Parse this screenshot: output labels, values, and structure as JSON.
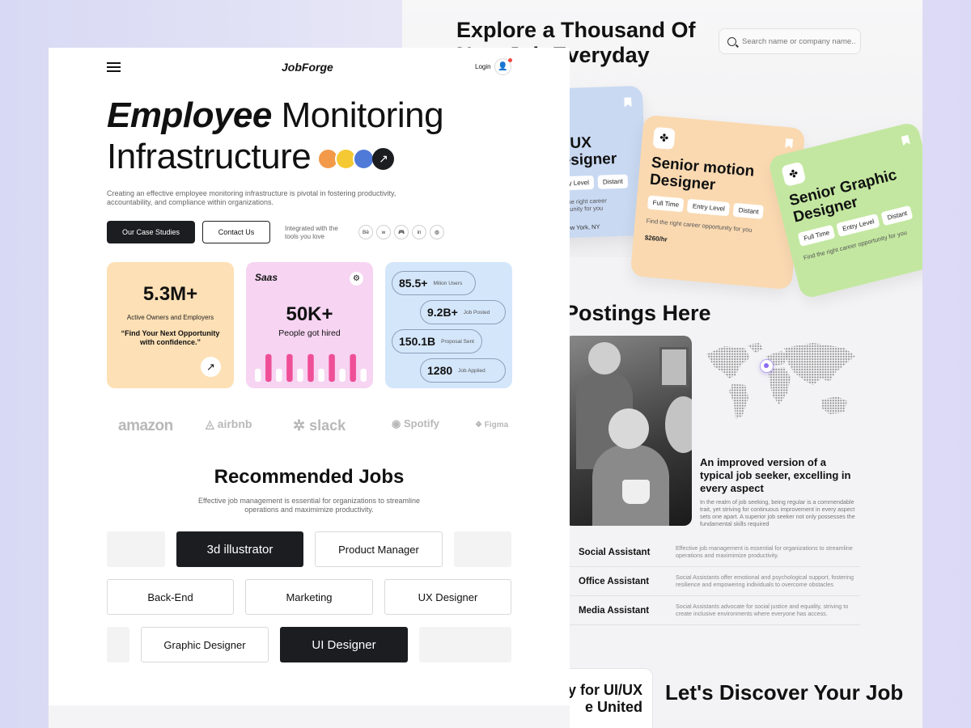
{
  "back": {
    "explore_title": "Explore a Thousand Of New Job Everyday",
    "search_placeholder": "Search name or company name..",
    "cards": [
      {
        "title": "UI/UX Designer",
        "tags": [
          "Entry Level",
          "Distant"
        ],
        "desc": "Find the right career opportunity for you",
        "location": "New York, NY",
        "color": "#c9d9f2"
      },
      {
        "title": "Senior motion Designer",
        "tags": [
          "Full Time",
          "Entry Level",
          "Distant"
        ],
        "desc": "Find the right career opportunity for you",
        "pay": "$260/hr",
        "color": "#fad9b1"
      },
      {
        "title": "Senior Graphic Designer",
        "tags": [
          "Full Time",
          "Entry Level",
          "Distant"
        ],
        "desc": "Find the right career opportunity for you",
        "color": "#c3e7a0"
      }
    ],
    "postings_title": "Postings Here",
    "improved_title": "An improved version of a typical job seeker, excelling in every aspect",
    "improved_desc": "In the realm of job seeking, being regular is a commendable trait, yet striving for continuous improvement in every aspect sets one apart. A superior job seeker not only possesses the fundamental skills required",
    "roles": [
      {
        "name": "Social Assistant",
        "desc": "Effective job management is essential for organizations to streamline operations and maximimize productivity."
      },
      {
        "name": "Office Assistant",
        "desc": "Social Assistants offer emotional and psychological support, fostering resilience and empowering individuals to overcome obstacles"
      },
      {
        "name": "Media Assistant",
        "desc": "Social Assistants advocate for social justice and equality, striving to create inclusive environments where everyone has access."
      }
    ],
    "disc_card": "y for UI/UX e United",
    "disc_title": "Let's Discover Your Job"
  },
  "front": {
    "logo": "JobForge",
    "login": "Login",
    "hero_italic": "Employee",
    "hero_rest": "Monitoring",
    "hero_line2": "Infrastructure",
    "hero_desc": "Creating an effective employee monitoring infrastructure is pivotal in fostering productivity, accountability, and compliance within organizations.",
    "btn_case": "Our Case Studies",
    "btn_contact": "Contact Us",
    "integrated": "Integrated with the tools you love",
    "tools": [
      "Bē",
      "w",
      "🎮",
      "in",
      "◍"
    ],
    "stat1": {
      "value": "5.3M+",
      "label": "Active Owners and Employers",
      "quote": "“Find Your Next Opportunity with confidence.”"
    },
    "stat2": {
      "label": "Saas",
      "value": "50K+",
      "sub": "People got hired",
      "bars": [
        0.45,
        0.95,
        0.45,
        0.95,
        0.45,
        0.95,
        0.45,
        0.95,
        0.45,
        0.95,
        0.45
      ]
    },
    "stat3": [
      {
        "value": "85.5+",
        "label": "Milion Users"
      },
      {
        "value": "9.2B+",
        "label": "Job Posted"
      },
      {
        "value": "150.1B",
        "label": "Proposal Sent"
      },
      {
        "value": "1280",
        "label": "Job Applied"
      }
    ],
    "brands": [
      "amazon",
      "airbnb",
      "slack",
      "Spotify",
      "Figma"
    ],
    "rec_title": "Recommended Jobs",
    "rec_desc": "Effective job management is essential for organizations to streamline operations and maximimize productivity.",
    "chips": {
      "row1": [
        "3d illustrator",
        "Product Manager"
      ],
      "row2": [
        "Back-End",
        "Marketing",
        "UX Designer"
      ],
      "row3": [
        "Graphic Designer",
        "UI Designer"
      ]
    }
  },
  "colors": {
    "dark": "#1b1d20",
    "stat_orange": "#fde0b5",
    "stat_pink": "#f6d4f2",
    "stat_blue": "#d4e6fa",
    "bar_pink": "#ef4f96"
  }
}
